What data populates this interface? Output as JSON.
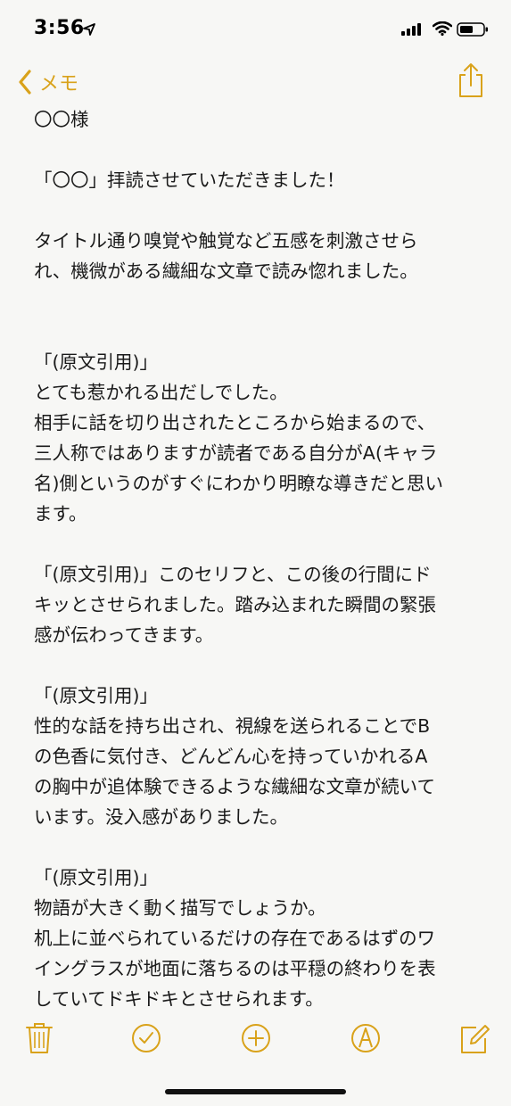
{
  "status_bar": {
    "time": "3:56"
  },
  "nav": {
    "back_label": "メモ"
  },
  "note": {
    "lines": [
      "〇〇様",
      "",
      "「〇〇」拝読させていただきました！",
      "",
      "タイトル通り嗅覚や触覚など五感を刺激させら",
      "れ、機微がある繊細な文章で読み惚れました。",
      "",
      "",
      "「(原文引用)」",
      "とても惹かれる出だしでした。",
      "相手に話を切り出されたところから始まるので、",
      "三人称ではありますが読者である自分がA(キャラ",
      "名)側というのがすぐにわかり明瞭な導きだと思い",
      "ます。",
      "",
      "「(原文引用)」このセリフと、この後の行間にド",
      "キッとさせられました。踏み込まれた瞬間の緊張",
      "感が伝わってきます。",
      "",
      "「(原文引用)」",
      "性的な話を持ち出され、視線を送られることでB",
      "の色香に気付き、どんどん心を持っていかれるA",
      "の胸中が追体験できるような繊細な文章が続いて",
      "います。没入感がありました。",
      "",
      "「(原文引用)」",
      "物語が大きく動く描写でしょうか。",
      "机上に並べられているだけの存在であるはずのワ",
      "イングラスが地面に落ちるのは平穏の終わりを表",
      "していてドキドキとさせられます。"
    ]
  },
  "toolbar": {
    "delete": "trash-icon",
    "checklist": "checklist-icon",
    "add": "add-icon",
    "markup": "markup-icon",
    "compose": "compose-icon"
  },
  "colors": {
    "accent": "#d9a21a",
    "background": "#f7f7f5",
    "text": "#1a1a1a"
  }
}
